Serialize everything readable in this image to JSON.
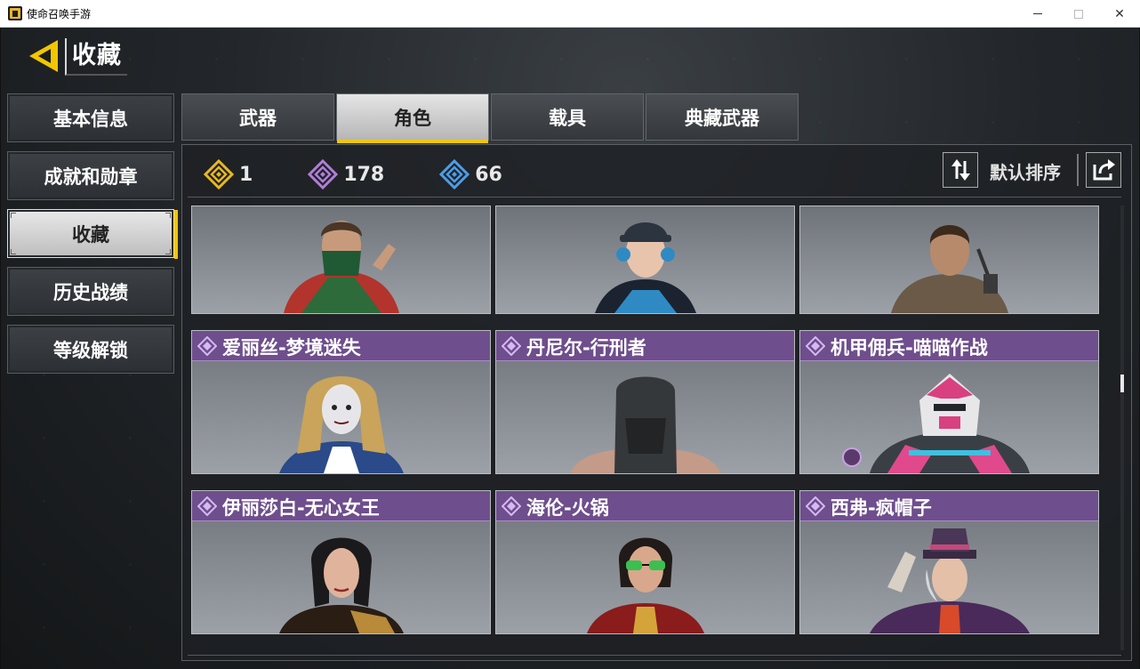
{
  "window": {
    "title": "使命召唤手游",
    "minimize": "minimize",
    "maximize": "maximize",
    "close": "✕"
  },
  "page": {
    "title": "收藏"
  },
  "sidebar": {
    "items": [
      {
        "label": "基本信息",
        "active": false
      },
      {
        "label": "成就和勋章",
        "active": false
      },
      {
        "label": "收藏",
        "active": true
      },
      {
        "label": "历史战绩",
        "active": false
      },
      {
        "label": "等级解锁",
        "active": false
      }
    ]
  },
  "tabs": [
    {
      "label": "武器",
      "active": false
    },
    {
      "label": "角色",
      "active": true
    },
    {
      "label": "载具",
      "active": false
    },
    {
      "label": "典藏武器",
      "active": false
    }
  ],
  "stats": [
    {
      "icon": "gold-diamond-icon",
      "color": "#e6b822",
      "value": "1"
    },
    {
      "icon": "purple-diamond-icon",
      "color": "#b07ed8",
      "value": "178"
    },
    {
      "icon": "blue-diamond-icon",
      "color": "#4d9de6",
      "value": "66"
    }
  ],
  "sort": {
    "label": "默认排序",
    "icon": "sort-arrows-icon",
    "share_icon": "share-icon"
  },
  "cards_row1": [
    {
      "name": "",
      "portrait": "soldier-green-mask"
    },
    {
      "name": "",
      "portrait": "woman-headset"
    },
    {
      "name": "",
      "portrait": "man-hood-radio"
    }
  ],
  "cards_row2": [
    {
      "name": "爱丽丝-梦境迷失",
      "portrait": "alice-blonde"
    },
    {
      "name": "丹尼尔-行刑者",
      "portrait": "hooded-executioner"
    },
    {
      "name": "机甲佣兵-喵喵作战",
      "portrait": "mech-pink"
    }
  ],
  "cards_row3": [
    {
      "name": "伊丽莎白-无心女王",
      "portrait": "elizabeth-dark-hair"
    },
    {
      "name": "海伦-火锅",
      "portrait": "helen-sunglasses"
    },
    {
      "name": "西弗-疯帽子",
      "portrait": "mad-hatter"
    }
  ],
  "colors": {
    "accent": "#f2c600",
    "epic_header": "#6e4e8c"
  }
}
